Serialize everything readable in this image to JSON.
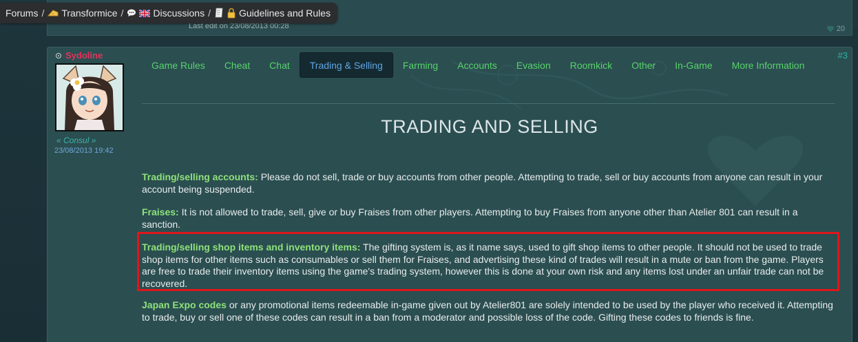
{
  "breadcrumb": {
    "items": [
      {
        "label": "Forums",
        "icon": ""
      },
      {
        "label": "Transformice",
        "icon": "cheese-icon"
      },
      {
        "label": "Discussions",
        "icon": "speech-bubble-uk-flag-icon"
      },
      {
        "label": "Guidelines and Rules",
        "icon": "scroll-lock-icon"
      }
    ],
    "separator": "/"
  },
  "previous_post": {
    "edit_text": "Last edit on 23/08/2013 00:28",
    "likes": "20"
  },
  "post": {
    "username": "Sydoline",
    "username_color": "#e6325a",
    "rank": "« Consul »",
    "date": "23/08/2013 19:42",
    "number": "#3",
    "tabs": [
      {
        "label": "Game Rules",
        "active": false
      },
      {
        "label": "Cheat",
        "active": false
      },
      {
        "label": "Chat",
        "active": false
      },
      {
        "label": "Trading & Selling",
        "active": true
      },
      {
        "label": "Farming",
        "active": false
      },
      {
        "label": "Accounts",
        "active": false
      },
      {
        "label": "Evasion",
        "active": false
      },
      {
        "label": "Roomkick",
        "active": false
      },
      {
        "label": "Other",
        "active": false
      },
      {
        "label": "In-Game",
        "active": false
      },
      {
        "label": "More Information",
        "active": false
      }
    ],
    "title": "TRADING AND SELLING",
    "paragraphs": [
      {
        "heading": "Trading/selling accounts:",
        "text": " Please do not sell, trade or buy accounts from other people. Attempting to trade, sell or buy accounts from anyone can result in your account being suspended."
      },
      {
        "heading": "Fraises:",
        "text": " It is not allowed to trade, sell, give or buy Fraises from other players. Attempting to buy Fraises from anyone other than Atelier 801 can result in a sanction."
      },
      {
        "heading": "Trading/selling shop items and inventory items:",
        "text": " The gifting system is, as it name says, used to gift shop items to other people. It should not be used to trade shop items for other items such as consumables or sell them for Fraises, and advertising these kind of trades will result in a mute or ban from the game. Players are free to trade their inventory items using the game's trading system, however this is done at your own risk and any items lost under an unfair trade can not be recovered."
      },
      {
        "heading": "Japan Expo codes",
        "text": " or any promotional items redeemable in-game given out by Atelier801 are solely intended to be used by the player who received it. Attempting to trade, buy or sell one of these codes can result in a ban from a moderator and possible loss of the code. Gifting these codes to friends is fine."
      }
    ]
  },
  "colors": {
    "accent_green": "#58d36a",
    "active_tab_text": "#5fa6e6",
    "heading_green": "#8ee27a",
    "highlight_red": "#e0161a"
  }
}
